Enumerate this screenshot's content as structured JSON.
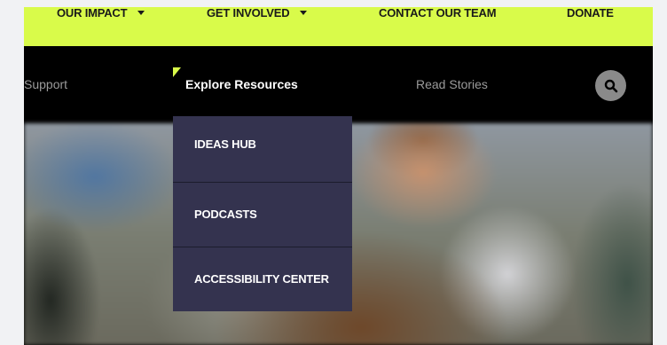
{
  "colors": {
    "accent": "#d9fb4a",
    "nav_bg": "#000000",
    "dropdown_bg": "#34334f",
    "search_bg": "#8a8a8a"
  },
  "topbar": {
    "items": [
      {
        "label": "OUR IMPACT",
        "has_dropdown": true
      },
      {
        "label": "GET INVOLVED",
        "has_dropdown": true
      },
      {
        "label": "CONTACT OUR TEAM",
        "has_dropdown": false
      },
      {
        "label": "DONATE",
        "has_dropdown": false
      }
    ]
  },
  "nav": {
    "links": [
      {
        "label": "Support",
        "active": false
      },
      {
        "label": "Explore Resources",
        "active": true
      },
      {
        "label": "Read Stories",
        "active": false
      }
    ],
    "search_icon": "search-icon"
  },
  "dropdown": {
    "items": [
      {
        "label": "IDEAS HUB"
      },
      {
        "label": "PODCASTS"
      },
      {
        "label": "ACCESSIBILITY CENTER"
      }
    ]
  }
}
